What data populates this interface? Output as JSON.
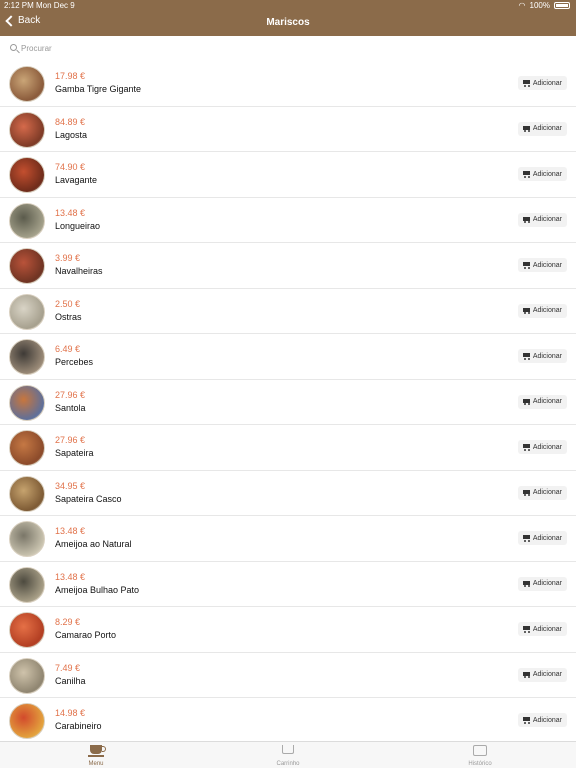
{
  "status": {
    "time": "2:12 PM",
    "date": "Mon Dec 9",
    "battery": "100%"
  },
  "nav": {
    "back_label": "Back",
    "title": "Mariscos"
  },
  "search": {
    "placeholder": "Procurar",
    "value": ""
  },
  "items": [
    {
      "price": "17.98 €",
      "name": "Gamba Tigre Gigante",
      "add": "Adicionar",
      "thumb_colors": [
        "#caa577",
        "#8a5a3a"
      ]
    },
    {
      "price": "84.89 €",
      "name": "Lagosta",
      "add": "Adicionar",
      "thumb_colors": [
        "#d56a4b",
        "#7d3a26"
      ]
    },
    {
      "price": "74.90 €",
      "name": "Lavagante",
      "add": "Adicionar",
      "thumb_colors": [
        "#c34f2f",
        "#6e2b1a"
      ]
    },
    {
      "price": "13.48 €",
      "name": "Longueirao",
      "add": "Adicionar",
      "thumb_colors": [
        "#5b5b4c",
        "#a3a08a"
      ]
    },
    {
      "price": "3.99 €",
      "name": "Navalheiras",
      "add": "Adicionar",
      "thumb_colors": [
        "#b9533a",
        "#6e3322"
      ]
    },
    {
      "price": "2.50 €",
      "name": "Ostras",
      "add": "Adicionar",
      "thumb_colors": [
        "#d9d4c6",
        "#a6a08e"
      ]
    },
    {
      "price": "6.49 €",
      "name": "Percebes",
      "add": "Adicionar",
      "thumb_colors": [
        "#3e3a36",
        "#9a8a77"
      ]
    },
    {
      "price": "27.96 €",
      "name": "Santola",
      "add": "Adicionar",
      "thumb_colors": [
        "#c8763d",
        "#5e6f9a"
      ]
    },
    {
      "price": "27.96 €",
      "name": "Sapateira",
      "add": "Adicionar",
      "thumb_colors": [
        "#c57844",
        "#8b4a2a"
      ]
    },
    {
      "price": "34.95 €",
      "name": "Sapateira Casco",
      "add": "Adicionar",
      "thumb_colors": [
        "#c6a36e",
        "#7d5a34"
      ]
    },
    {
      "price": "13.48 €",
      "name": "Ameijoa ao Natural",
      "add": "Adicionar",
      "thumb_colors": [
        "#7a7668",
        "#c8c2ae"
      ]
    },
    {
      "price": "13.48 €",
      "name": "Ameijoa Bulhao Pato",
      "add": "Adicionar",
      "thumb_colors": [
        "#4d4a3f",
        "#a79e86"
      ]
    },
    {
      "price": "8.29 €",
      "name": "Camarao Porto",
      "add": "Adicionar",
      "thumb_colors": [
        "#e57046",
        "#b23e22"
      ]
    },
    {
      "price": "7.49 €",
      "name": "Canilha",
      "add": "Adicionar",
      "thumb_colors": [
        "#cfc3ab",
        "#8f8570"
      ]
    },
    {
      "price": "14.98 €",
      "name": "Carabineiro",
      "add": "Adicionar",
      "thumb_colors": [
        "#d24a2c",
        "#e3a23d"
      ]
    }
  ],
  "tabs": [
    {
      "label": "Menu",
      "icon": "coffee-cup-icon",
      "active": true
    },
    {
      "label": "Carrinho",
      "icon": "cart-icon",
      "active": false
    },
    {
      "label": "Histórico",
      "icon": "history-icon",
      "active": false
    }
  ],
  "colors": {
    "brand": "#8B6B4A",
    "price": "#E1724A"
  }
}
